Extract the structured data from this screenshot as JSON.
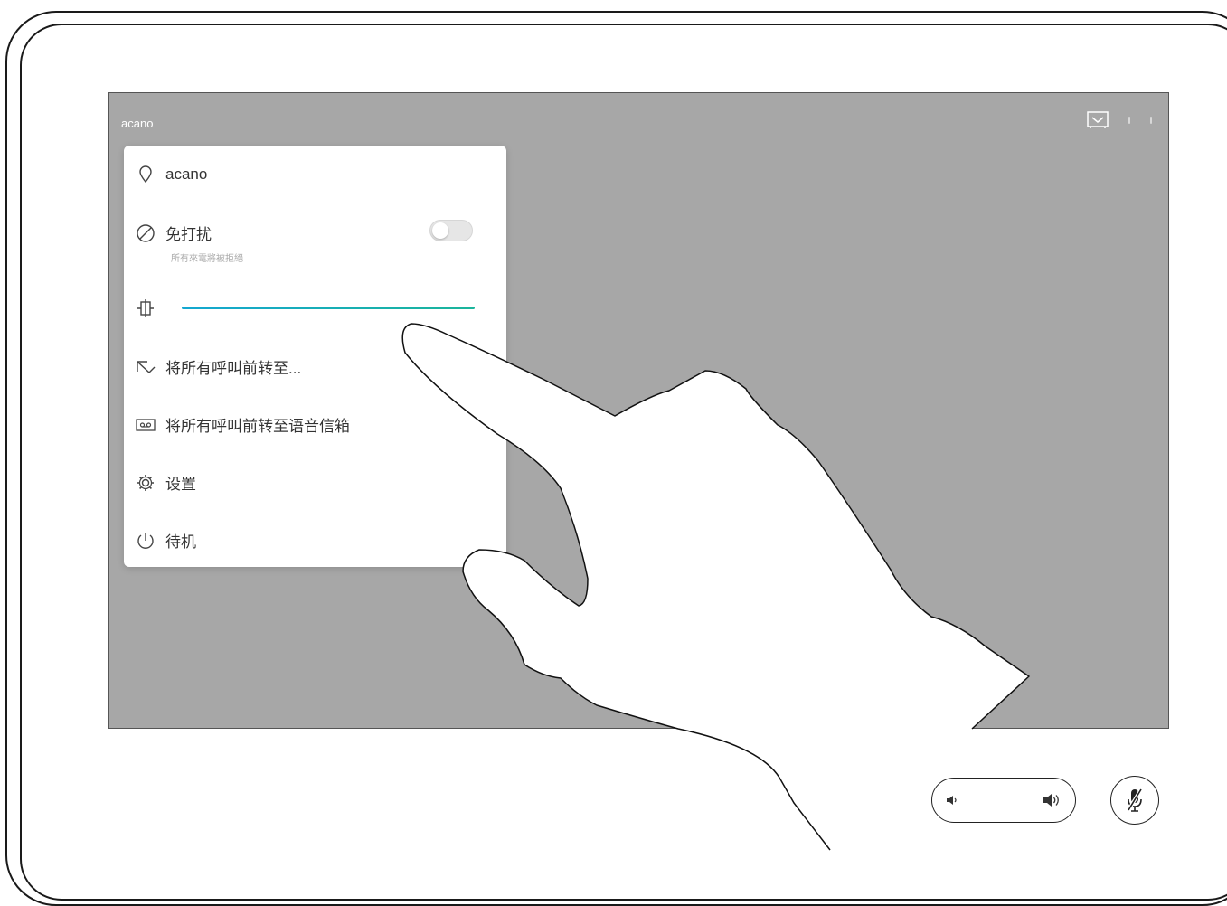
{
  "screen": {
    "title": "acano"
  },
  "menu": {
    "items": [
      {
        "label": "acano",
        "icon": "location-pin-icon"
      },
      {
        "label": "免打扰",
        "icon": "do-not-disturb-icon",
        "sublabel": "所有來電將被拒絕"
      },
      {
        "label": "",
        "icon": "brightness-icon"
      },
      {
        "label": "将所有呼叫前转至...",
        "icon": "forward-icon"
      },
      {
        "label": "将所有呼叫前转至语音信箱",
        "icon": "voicemail-icon"
      },
      {
        "label": "设置",
        "icon": "gear-icon"
      },
      {
        "label": "待机",
        "icon": "power-icon"
      }
    ],
    "do_not_disturb_on": false,
    "brightness_level": 1.0
  },
  "colors": {
    "screen_bg": "#a7a7a7",
    "slider_blue": "#14a7d1",
    "slider_teal": "#1ab59b"
  }
}
